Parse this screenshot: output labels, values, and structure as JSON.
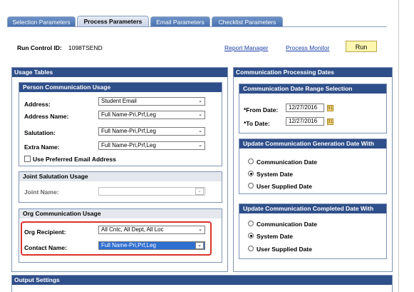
{
  "tabs": [
    "Selection Parameters",
    "Process Parameters",
    "Email Parameters",
    "Checklist Parameters"
  ],
  "run_control": {
    "label": "Run Control ID:",
    "value": "1098TSEND"
  },
  "links": {
    "report_manager": "Report Manager",
    "process_monitor": "Process Monitor"
  },
  "run_button": "Run",
  "usage_tables": {
    "title": "Usage Tables",
    "person": {
      "title": "Person Communication Usage",
      "address_label": "Address:",
      "address_value": "Student Email",
      "address_name_label": "Address Name:",
      "address_name_value": "Full Name-Pri,Prf,Leg",
      "salutation_label": "Salutation:",
      "salutation_value": "Full Name-Pri,Prf,Leg",
      "extra_name_label": "Extra Name:",
      "extra_name_value": "Full Name-Pri,Prf,Leg",
      "preferred_email_label": "Use Preferred Email Address"
    },
    "joint": {
      "title": "Joint Salutation Usage",
      "joint_name_label": "Joint Name:",
      "joint_name_value": ""
    },
    "org": {
      "title": "Org Communication Usage",
      "org_recipient_label": "Org Recipient:",
      "org_recipient_value": "All Cntc, All Dept, All Loc",
      "contact_name_label": "Contact Name:",
      "contact_name_value": "Full Name-Pri,Prf,Leg"
    }
  },
  "comm_dates": {
    "title": "Communication Processing Dates",
    "range": {
      "title": "Communication Date Range Selection",
      "from_label": "*From Date:",
      "from_value": "12/27/2016",
      "to_label": "*To Date:",
      "to_value": "12/27/2016"
    },
    "generation": {
      "title": "Update Communication Generation Date With",
      "options": [
        "Communication Date",
        "System Date",
        "User Supplied Date"
      ],
      "selected": "System Date"
    },
    "completed": {
      "title": "Update Communication Completed Date With",
      "options": [
        "Communication Date",
        "System Date",
        "User Supplied Date"
      ],
      "selected": "System Date"
    }
  },
  "output_settings": {
    "title": "Output Settings"
  },
  "colors": {
    "header_bg": "#2f4f8a",
    "tab_bg": "#4a71b0",
    "run_bg": "#fff7b0",
    "highlight_border": "#d9342b",
    "selected_field": "#2f6fd0"
  },
  "icons": [
    "calendar-icon",
    "dropdown-arrow-icon",
    "radio-icon",
    "checkbox-icon"
  ]
}
